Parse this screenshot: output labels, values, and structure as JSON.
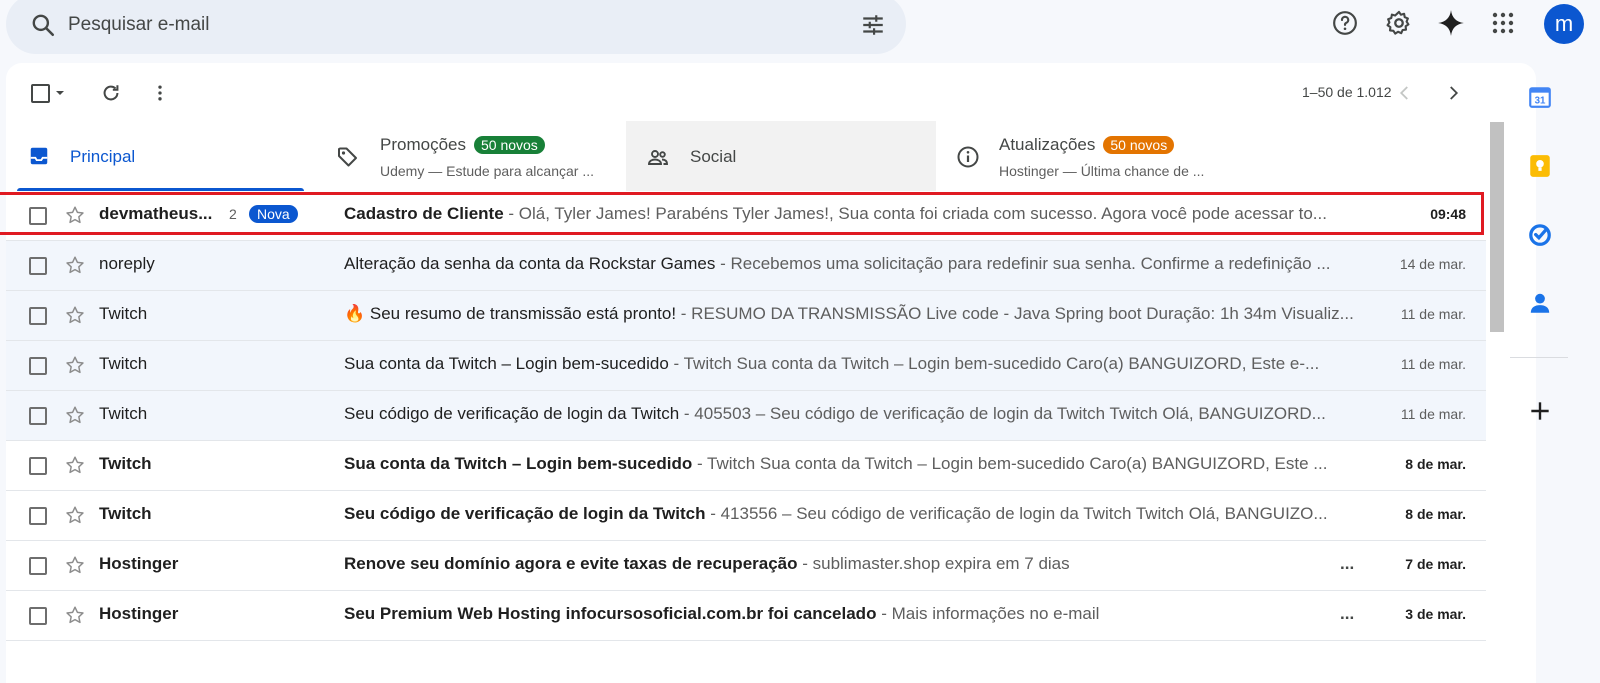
{
  "search": {
    "placeholder": "Pesquisar e-mail"
  },
  "header": {
    "avatar_letter": "m"
  },
  "toolbar": {
    "pager_text": "1–50 de 1.012"
  },
  "tabs": [
    {
      "label": "Principal",
      "selected": true
    },
    {
      "label": "Promoções",
      "badge": "50 novos",
      "sub": "Udemy — Estude para alcançar ..."
    },
    {
      "label": "Social"
    },
    {
      "label": "Atualizações",
      "badge": "50 novos",
      "sub": "Hostinger — Última chance de ..."
    }
  ],
  "emails": [
    {
      "sender": "devmatheus...",
      "count": "2",
      "tag": "Nova",
      "subject": "Cadastro de Cliente",
      "snippet": " - Olá, Tyler James! Parabéns Tyler James!, Sua conta foi criada com sucesso. Agora você pode acessar to...",
      "date": "09:48",
      "unread": true
    },
    {
      "sender": "noreply",
      "subject": "Alteração da senha da conta da Rockstar Games",
      "snippet": " - Recebemos uma solicitação para redefinir sua senha. Confirme a redefinição ...",
      "date": "14 de mar.",
      "unread": false
    },
    {
      "sender": "Twitch",
      "subject": "🔥 Seu resumo de transmissão está pronto!",
      "snippet": " - RESUMO DA TRANSMISSÃO Live code - Java Spring boot Duração: 1h 34m Visualiz...",
      "date": "11 de mar.",
      "unread": false
    },
    {
      "sender": "Twitch",
      "subject": "Sua conta da Twitch – Login bem-sucedido",
      "snippet": " - Twitch Sua conta da Twitch – Login bem-sucedido Caro(a) BANGUIZORD, Este e-...",
      "date": "11 de mar.",
      "unread": false
    },
    {
      "sender": "Twitch",
      "subject": "Seu código de verificação de login da Twitch",
      "snippet": " - 405503 – Seu código de verificação de login da Twitch Twitch Olá, BANGUIZORD...",
      "date": "11 de mar.",
      "unread": false
    },
    {
      "sender": "Twitch",
      "subject": "Sua conta da Twitch – Login bem-sucedido",
      "snippet": " - Twitch Sua conta da Twitch – Login bem-sucedido Caro(a) BANGUIZORD, Este ...",
      "date": "8 de mar.",
      "unread": true
    },
    {
      "sender": "Twitch",
      "subject": "Seu código de verificação de login da Twitch",
      "snippet": " - 413556 – Seu código de verificação de login da Twitch Twitch Olá, BANGUIZO...",
      "date": "8 de mar.",
      "unread": true
    },
    {
      "sender": "Hostinger",
      "subject": "Renove seu domínio agora e evite taxas de recuperação",
      "snippet": " - sublimaster.shop expira em 7 dias",
      "dots": "...",
      "date": "7 de mar.",
      "unread": true
    },
    {
      "sender": "Hostinger",
      "subject": "Seu Premium Web Hosting infocursosoficial.com.br foi cancelado",
      "snippet": " - Mais informações no e-mail",
      "dots": "...",
      "date": "3 de mar.",
      "unread": true
    }
  ],
  "colors": {
    "accent": "#0b57d0",
    "highlight": "#e01a22",
    "badge_green": "#188038",
    "badge_orange": "#e37400"
  },
  "icons": [
    "search-icon",
    "filter-icon",
    "help-icon",
    "gear-icon",
    "gemini-icon",
    "apps-icon",
    "inbox-icon",
    "tag-icon",
    "people-icon",
    "info-icon",
    "star-icon",
    "calendar-icon",
    "keep-icon",
    "tasks-icon",
    "contacts-icon",
    "plus-icon"
  ]
}
